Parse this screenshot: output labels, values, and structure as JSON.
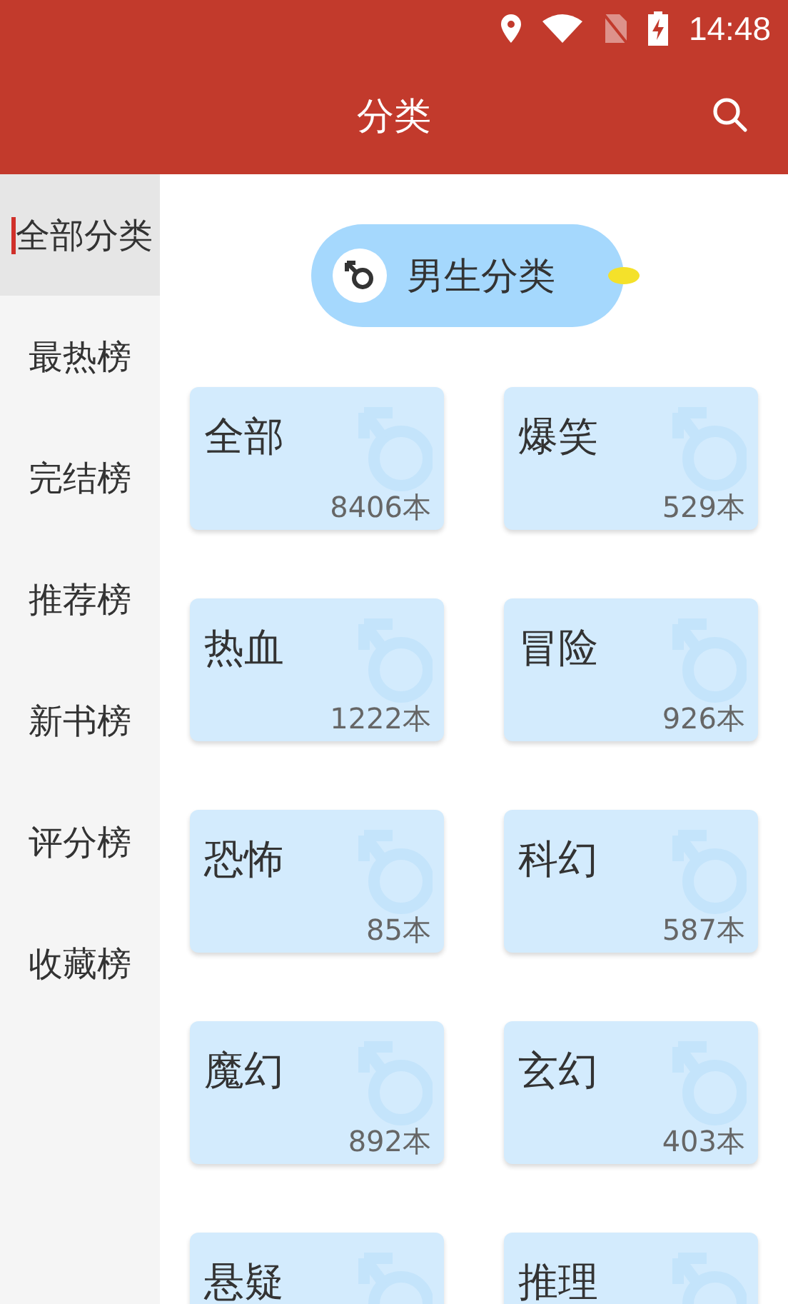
{
  "status_bar": {
    "time": "14:48"
  },
  "app_bar": {
    "title": "分类"
  },
  "sidebar": {
    "items": [
      {
        "label": "全部分类",
        "selected": true
      },
      {
        "label": "最热榜",
        "selected": false
      },
      {
        "label": "完结榜",
        "selected": false
      },
      {
        "label": "推荐榜",
        "selected": false
      },
      {
        "label": "新书榜",
        "selected": false
      },
      {
        "label": "评分榜",
        "selected": false
      },
      {
        "label": "收藏榜",
        "selected": false
      }
    ]
  },
  "section": {
    "title": "男生分类"
  },
  "categories": [
    {
      "name": "全部",
      "count": "8406本"
    },
    {
      "name": "爆笑",
      "count": "529本"
    },
    {
      "name": "热血",
      "count": "1222本"
    },
    {
      "name": "冒险",
      "count": "926本"
    },
    {
      "name": "恐怖",
      "count": "85本"
    },
    {
      "name": "科幻",
      "count": "587本"
    },
    {
      "name": "魔幻",
      "count": "892本"
    },
    {
      "name": "玄幻",
      "count": "403本"
    },
    {
      "name": "悬疑"
    },
    {
      "name": "推理"
    }
  ]
}
